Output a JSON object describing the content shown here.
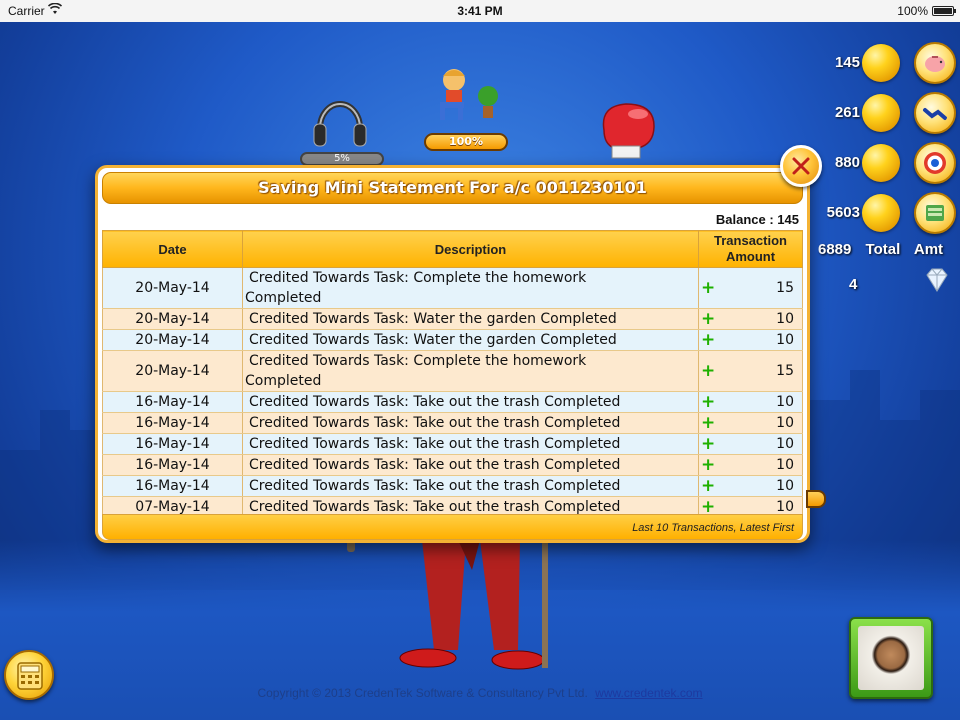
{
  "status_bar": {
    "carrier": "Carrier",
    "time": "3:41 PM",
    "battery": "100%"
  },
  "top_items": {
    "headphone_progress": "5%",
    "boy_progress": "100%"
  },
  "stats": [
    {
      "value": "145",
      "icon": "piggy-bank-icon"
    },
    {
      "value": "261",
      "icon": "handshake-icon"
    },
    {
      "value": "880",
      "icon": "target-icon"
    },
    {
      "value": "5603",
      "icon": "cash-stack-icon"
    }
  ],
  "total": {
    "value": "6889",
    "label_total": "Total",
    "label_amt": "Amt"
  },
  "gems": {
    "count": "4",
    "icon": "diamond-icon"
  },
  "modal": {
    "title": "Saving Mini Statement For a/c 0011230101",
    "balance": "Balance : 145",
    "columns": {
      "date": "Date",
      "description": "Description",
      "amount": "Transaction Amount"
    },
    "rows": [
      {
        "date": "20-May-14",
        "description_l1": "Credited Towards Task: Complete the homework",
        "description_l2": "Completed",
        "sign": "+",
        "amount": "15"
      },
      {
        "date": "20-May-14",
        "description_l1": "Credited Towards Task: Water the garden Completed",
        "description_l2": "",
        "sign": "+",
        "amount": "10"
      },
      {
        "date": "20-May-14",
        "description_l1": "Credited Towards Task: Water the garden Completed",
        "description_l2": "",
        "sign": "+",
        "amount": "10"
      },
      {
        "date": "20-May-14",
        "description_l1": "Credited Towards Task: Complete the homework",
        "description_l2": "Completed",
        "sign": "+",
        "amount": "15"
      },
      {
        "date": "16-May-14",
        "description_l1": "Credited Towards Task: Take out the trash Completed",
        "description_l2": "",
        "sign": "+",
        "amount": "10"
      },
      {
        "date": "16-May-14",
        "description_l1": "Credited Towards Task: Take out the trash Completed",
        "description_l2": "",
        "sign": "+",
        "amount": "10"
      },
      {
        "date": "16-May-14",
        "description_l1": "Credited Towards Task: Take out the trash Completed",
        "description_l2": "",
        "sign": "+",
        "amount": "10"
      },
      {
        "date": "16-May-14",
        "description_l1": "Credited Towards Task: Take out the trash Completed",
        "description_l2": "",
        "sign": "+",
        "amount": "10"
      },
      {
        "date": "16-May-14",
        "description_l1": "Credited Towards Task: Take out the trash Completed",
        "description_l2": "",
        "sign": "+",
        "amount": "10"
      },
      {
        "date": "07-May-14",
        "description_l1": "Credited Towards Task: Take out the trash Completed",
        "description_l2": "",
        "sign": "+",
        "amount": "10"
      }
    ],
    "footer": "Last 10 Transactions, Latest First"
  },
  "footer": {
    "copyright": "Copyright © 2013 CredenTek Software & Consultancy Pvt Ltd.",
    "link": "www.credentek.com"
  },
  "colors": {
    "accent": "#ffb61c",
    "plus": "#1fb000",
    "row_blue": "#e5f3fb",
    "row_peach": "#fde9cf"
  }
}
